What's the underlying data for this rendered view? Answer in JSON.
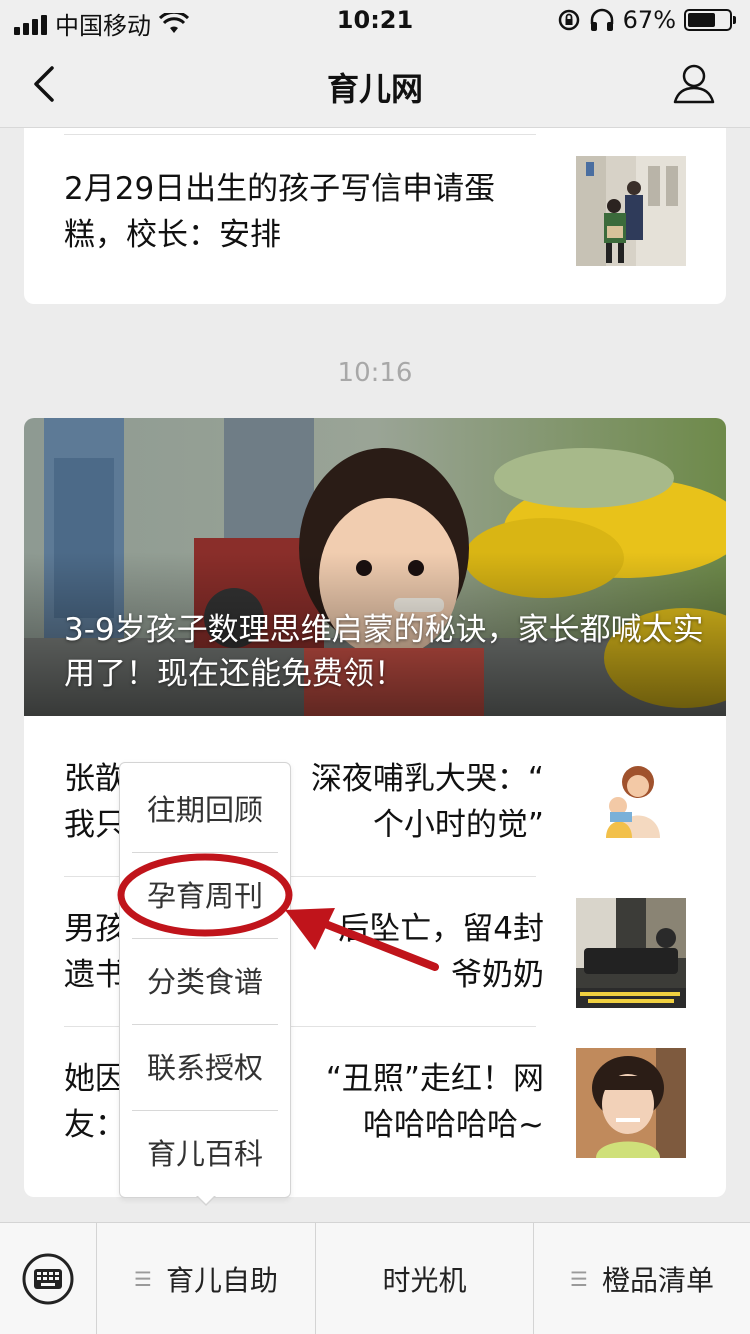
{
  "status_bar": {
    "carrier": "中国移动",
    "time": "10:21",
    "battery": "67%",
    "battery_level": 0.67
  },
  "nav": {
    "title": "育儿网",
    "back_icon": "chevron-left-icon",
    "profile_icon": "user-profile-icon"
  },
  "feed": {
    "prev_article": {
      "title": "2月29日出生的孩子写信申请蛋糕，校长：安排"
    },
    "timestamp": "10:16",
    "hero": {
      "title": "3-9岁孩子数理思维启蒙的秘诀，家长都喊太实用了！现在还能免费领！"
    },
    "articles": [
      {
        "title_line1": "张歆",
        "title_line1_end": "深夜哺乳大哭：“",
        "title_line2": "我只",
        "title_line2_end": "个小时的觉”"
      },
      {
        "title_line1": "男孩",
        "title_line1_end": "后坠亡，留4封",
        "title_line2": "遗书",
        "title_line2_end": "爷奶奶"
      },
      {
        "title_line1": "她因",
        "title_line1_end": "“丑照”走红！网",
        "title_line2": "友：",
        "title_line2_end": "哈哈哈哈哈~"
      }
    ]
  },
  "popup_menu": {
    "items": [
      "往期回顾",
      "孕育周刊",
      "分类食谱",
      "联系授权",
      "育儿百科"
    ],
    "highlighted": "孕育周刊"
  },
  "tabbar": {
    "keyboard_icon": "keyboard-icon",
    "tabs": [
      "育儿自助",
      "时光机",
      "橙品清单"
    ]
  },
  "colors": {
    "annotation": "#c0141b",
    "background": "#ececec"
  }
}
